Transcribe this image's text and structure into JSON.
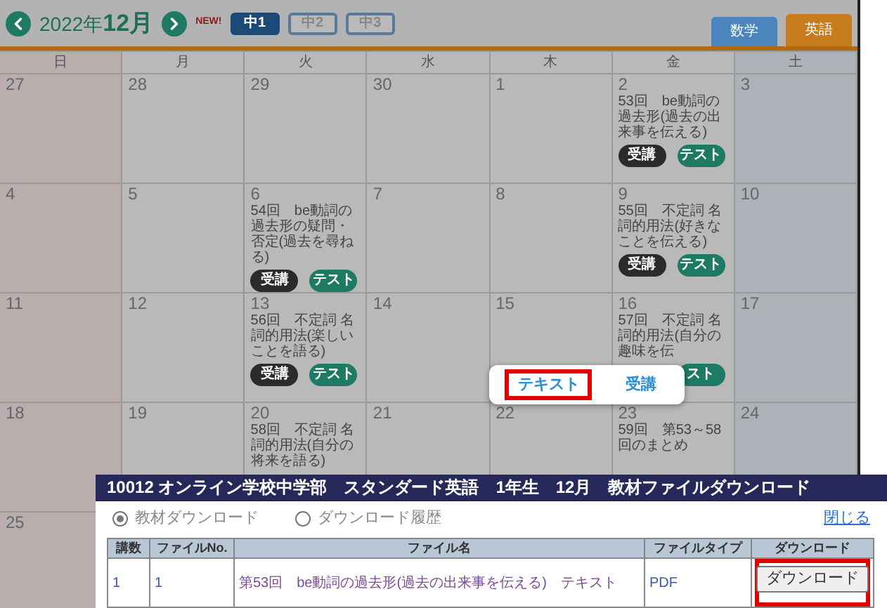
{
  "calendar": {
    "month_label": "2022年**12月**",
    "new_badge": "NEW!",
    "grade_tabs": [
      {
        "label": "中1",
        "selected": true
      },
      {
        "label": "中2",
        "selected": false
      },
      {
        "label": "中3",
        "selected": false
      }
    ],
    "subject_tabs": [
      {
        "label": "数学",
        "selected": false,
        "color": "#4a86bd"
      },
      {
        "label": "英語",
        "selected": true,
        "color": "#c67b1c"
      }
    ],
    "weekdays": [
      "日",
      "月",
      "火",
      "水",
      "木",
      "金",
      "土"
    ],
    "weeks": [
      [
        {
          "date": "27"
        },
        {
          "date": "28"
        },
        {
          "date": "29"
        },
        {
          "date": "30"
        },
        {
          "date": "1"
        },
        {
          "date": "2",
          "lesson": "53回　be動詞の過去形(過去の出来事を伝える)",
          "actions": [
            {
              "kind": "lecture",
              "label": "受講"
            },
            {
              "kind": "test",
              "label": "テスト"
            }
          ]
        },
        {
          "date": "3"
        }
      ],
      [
        {
          "date": "4"
        },
        {
          "date": "5"
        },
        {
          "date": "6",
          "lesson": "54回　be動詞の過去形の疑問・否定(過去を尋ねる)",
          "actions": [
            {
              "kind": "lecture",
              "label": "受講"
            },
            {
              "kind": "test",
              "label": "テスト"
            }
          ]
        },
        {
          "date": "7"
        },
        {
          "date": "8"
        },
        {
          "date": "9",
          "lesson": "55回　不定詞 名詞的用法(好きなことを伝える)",
          "actions": [
            {
              "kind": "lecture",
              "label": "受講"
            },
            {
              "kind": "test",
              "label": "テスト"
            }
          ]
        },
        {
          "date": "10"
        }
      ],
      [
        {
          "date": "11"
        },
        {
          "date": "12"
        },
        {
          "date": "13",
          "lesson": "56回　不定詞 名詞的用法(楽しいことを語る)",
          "actions": [
            {
              "kind": "lecture",
              "label": "受講"
            },
            {
              "kind": "test",
              "label": "テスト"
            }
          ]
        },
        {
          "date": "14"
        },
        {
          "date": "15"
        },
        {
          "date": "16",
          "lesson": "57回　不定詞 名詞的用法(自分の趣味を伝",
          "actions": [
            {
              "kind": "test",
              "label": "スト"
            }
          ]
        },
        {
          "date": "17"
        }
      ],
      [
        {
          "date": "18"
        },
        {
          "date": "19"
        },
        {
          "date": "20",
          "lesson": "58回　不定詞 名詞的用法(自分の将来を語る)"
        },
        {
          "date": "21"
        },
        {
          "date": "22"
        },
        {
          "date": "23",
          "lesson": "59回　第53～58回のまとめ"
        },
        {
          "date": "24"
        }
      ],
      [
        {
          "date": "25"
        }
      ]
    ]
  },
  "popup": {
    "items": [
      {
        "label": "テキスト",
        "highlighted": true
      },
      {
        "label": "受講",
        "highlighted": false
      }
    ]
  },
  "dialog": {
    "title": "10012 オンライン学校中学部　スタンダード英語　1年生　12月　教材ファイルダウンロード",
    "radios": [
      {
        "label": "教材ダウンロード",
        "selected": true
      },
      {
        "label": "ダウンロード履歴",
        "selected": false
      }
    ],
    "close_link": "閉じる",
    "columns": [
      "講数",
      "ファイルNo.",
      "ファイル名",
      "ファイルタイプ",
      "ダウンロード"
    ],
    "rows": [
      {
        "lecture_no": "1",
        "file_no": "1",
        "file_name": "第53回　be動詞の過去形(過去の出来事を伝える)　テキスト",
        "file_type": "PDF",
        "download": {
          "label": "ダウンロード",
          "highlighted": true
        }
      }
    ]
  }
}
